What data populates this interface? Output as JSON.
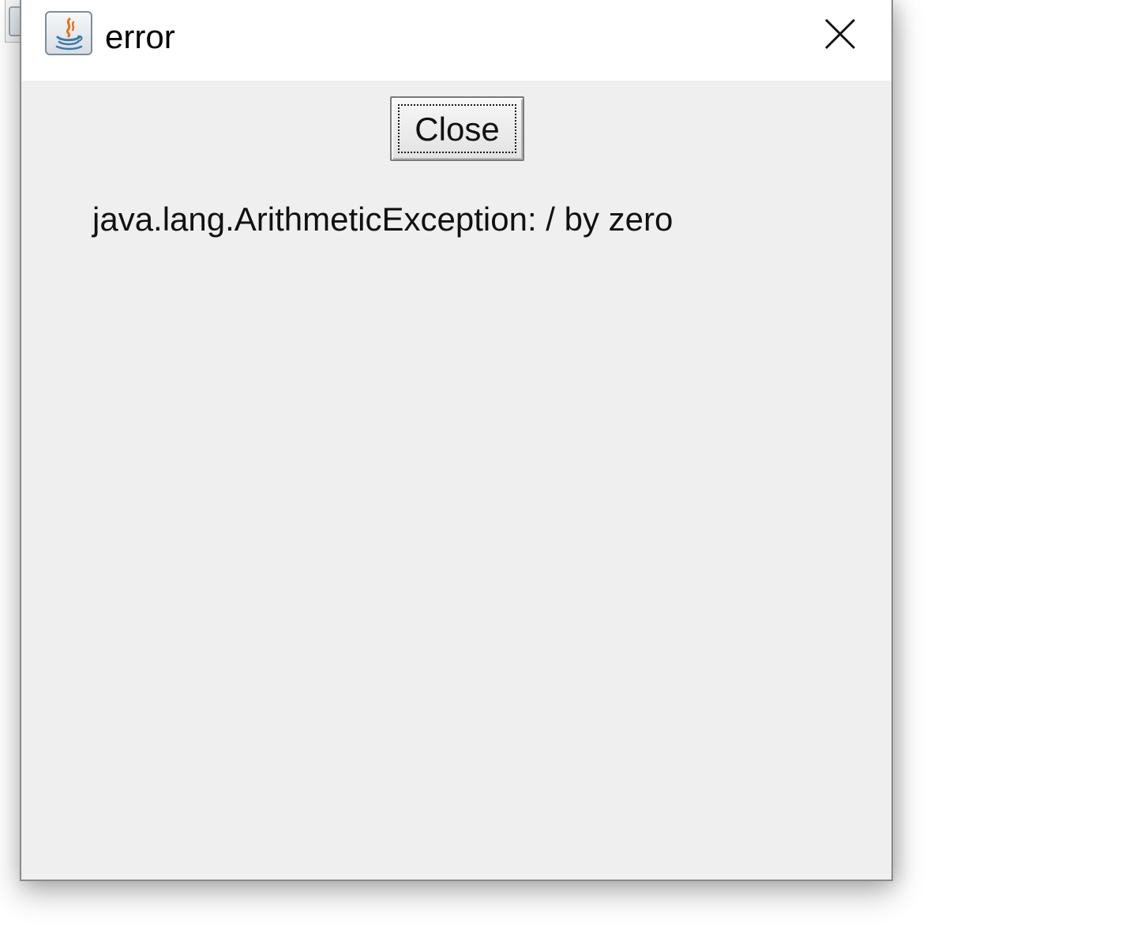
{
  "window": {
    "title": "error",
    "app_icon": "java-icon",
    "close_icon": "close-icon"
  },
  "dialog": {
    "close_button_label": "Close",
    "message": "java.lang.ArithmeticException: / by zero"
  },
  "colors": {
    "dialog_background": "#efefef",
    "titlebar_background": "#ffffff",
    "text": "#111111"
  }
}
